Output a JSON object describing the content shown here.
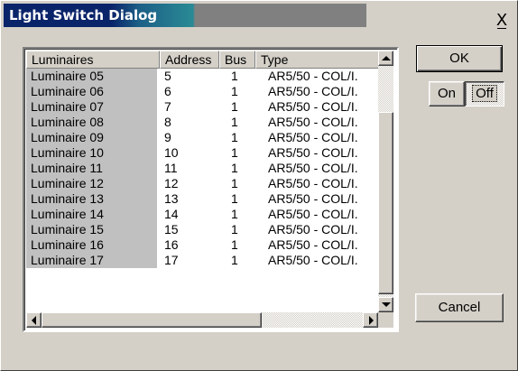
{
  "window": {
    "title": "Light Switch Dialog",
    "close_glyph": "X"
  },
  "list": {
    "columns": [
      "Luminaires",
      "Address",
      "Bus",
      "Type"
    ],
    "rows": [
      {
        "name": "Luminaire 05",
        "address": "5",
        "bus": "1",
        "type": "AR5/50 - COL/I."
      },
      {
        "name": "Luminaire 06",
        "address": "6",
        "bus": "1",
        "type": "AR5/50 - COL/I."
      },
      {
        "name": "Luminaire 07",
        "address": "7",
        "bus": "1",
        "type": "AR5/50 - COL/I."
      },
      {
        "name": "Luminaire 08",
        "address": "8",
        "bus": "1",
        "type": "AR5/50 - COL/I."
      },
      {
        "name": "Luminaire 09",
        "address": "9",
        "bus": "1",
        "type": "AR5/50 - COL/I."
      },
      {
        "name": "Luminaire 10",
        "address": "10",
        "bus": "1",
        "type": "AR5/50 - COL/I."
      },
      {
        "name": "Luminaire 11",
        "address": "11",
        "bus": "1",
        "type": "AR5/50 - COL/I."
      },
      {
        "name": "Luminaire 12",
        "address": "12",
        "bus": "1",
        "type": "AR5/50 - COL/I."
      },
      {
        "name": "Luminaire 13",
        "address": "13",
        "bus": "1",
        "type": "AR5/50 - COL/I."
      },
      {
        "name": "Luminaire 14",
        "address": "14",
        "bus": "1",
        "type": "AR5/50 - COL/I."
      },
      {
        "name": "Luminaire 15",
        "address": "15",
        "bus": "1",
        "type": "AR5/50 - COL/I."
      },
      {
        "name": "Luminaire 16",
        "address": "16",
        "bus": "1",
        "type": "AR5/50 - COL/I."
      },
      {
        "name": "Luminaire 17",
        "address": "17",
        "bus": "1",
        "type": "AR5/50 - COL/I."
      }
    ]
  },
  "buttons": {
    "ok": "OK",
    "on": "On",
    "off": "Off",
    "cancel": "Cancel"
  },
  "icons": {
    "scroll_up": "scroll-up-arrow-icon",
    "scroll_down": "scroll-down-arrow-icon",
    "scroll_left": "scroll-left-arrow-icon",
    "scroll_right": "scroll-right-arrow-icon"
  },
  "colors": {
    "title_active": "#0a246a",
    "title_gradient": "#2a8a95",
    "title_inactive": "#808080",
    "face": "#d4d0c8",
    "selected_column": "#c0c0c0"
  }
}
